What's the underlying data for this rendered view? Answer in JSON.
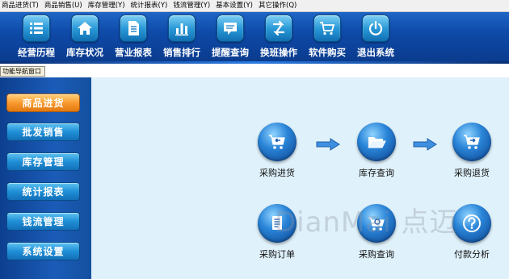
{
  "menu": [
    {
      "label": "商品进货(T)"
    },
    {
      "label": "商品销售(U)"
    },
    {
      "label": "库存管理(Y)"
    },
    {
      "label": "统计报表(Y)"
    },
    {
      "label": "钱流管理(Y)"
    },
    {
      "label": "基本设置(Y)"
    },
    {
      "label": "其它操作(Q)"
    }
  ],
  "toolbar": [
    {
      "label": "经营历程",
      "icon": "list-icon"
    },
    {
      "label": "库存状况",
      "icon": "home-icon"
    },
    {
      "label": "营业报表",
      "icon": "document-icon"
    },
    {
      "label": "销售排行",
      "icon": "bar-chart-icon"
    },
    {
      "label": "提醒查询",
      "icon": "message-icon"
    },
    {
      "label": "换班操作",
      "icon": "switch-icon"
    },
    {
      "label": "软件购买",
      "icon": "cart-icon"
    },
    {
      "label": "退出系统",
      "icon": "power-icon"
    }
  ],
  "nav": {
    "title": "功能导航窗口",
    "items": [
      {
        "label": "商品进货",
        "active": true
      },
      {
        "label": "批发销售",
        "active": false
      },
      {
        "label": "库存管理",
        "active": false
      },
      {
        "label": "统计报表",
        "active": false
      },
      {
        "label": "钱流管理",
        "active": false
      },
      {
        "label": "系统设置",
        "active": false
      }
    ]
  },
  "flow": {
    "row1": [
      {
        "label": "采购进货",
        "icon": "cart-in-icon"
      },
      {
        "label": "库存查询",
        "icon": "folder-open-icon"
      },
      {
        "label": "采购退货",
        "icon": "cart-return-icon"
      }
    ],
    "row2": [
      {
        "label": "采购订单",
        "icon": "order-document-icon"
      },
      {
        "label": "采购查询",
        "icon": "cart-search-icon"
      },
      {
        "label": "付款分析",
        "icon": "question-icon"
      }
    ]
  },
  "watermark": "DianMai 点迈",
  "colors": {
    "toolbar": "#0e4aa8",
    "panel": "#1b5cb8",
    "main_bg": "#dff1fb",
    "active_nav": "#f7962a",
    "nav_button": "#1f8fd6"
  }
}
